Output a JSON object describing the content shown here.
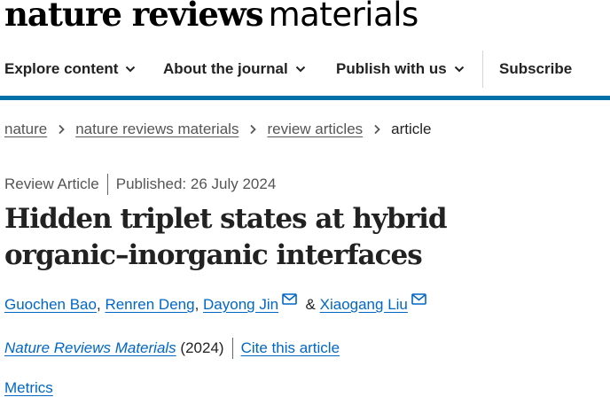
{
  "logo": {
    "bold_part": "nature reviews",
    "light_part": "materials"
  },
  "nav": {
    "items": [
      {
        "label": "Explore content"
      },
      {
        "label": "About the journal"
      },
      {
        "label": "Publish with us"
      }
    ],
    "subscribe": "Subscribe"
  },
  "accent_color": "#0070a8",
  "link_color": "#0067c5",
  "breadcrumb": {
    "items": [
      "nature",
      "nature reviews materials",
      "review articles"
    ],
    "current": "article"
  },
  "article": {
    "type": "Review Article",
    "published": "Published: 26 July 2024",
    "title": "Hidden triplet states at hybrid organic–inorganic interfaces",
    "authors": [
      "Guochen Bao",
      "Renren Deng",
      "Dayong Jin",
      "Xiaogang Liu"
    ],
    "author_separator": ",",
    "author_last_separator": "&",
    "journal": "Nature Reviews Materials",
    "year": "(2024)",
    "cite": "Cite this article",
    "metrics": "Metrics"
  }
}
